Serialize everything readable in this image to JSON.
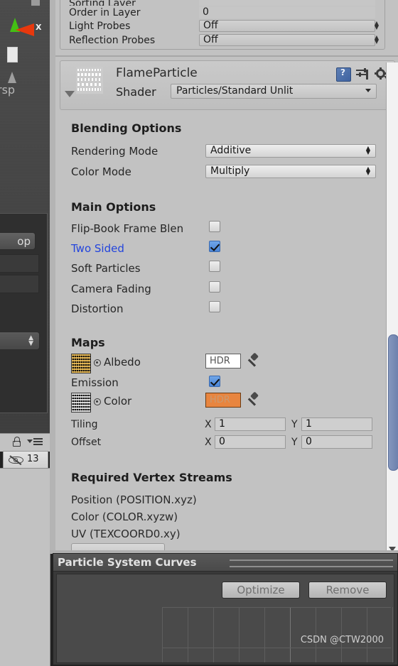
{
  "scene_view": {
    "gizmo_axis_label": "X",
    "projection_label": "rsp",
    "popup_button_label": "op"
  },
  "left_toolbar": {
    "eye_count": "13"
  },
  "renderer_section": {
    "rows": [
      {
        "label": "Sorting Layer",
        "value": "",
        "type": "plain"
      },
      {
        "label": "Order in Layer",
        "value": "0",
        "type": "plain"
      },
      {
        "label": "Light Probes",
        "value": "Off",
        "type": "dropdown"
      },
      {
        "label": "Reflection Probes",
        "value": "Off",
        "type": "dropdown"
      }
    ]
  },
  "material_header": {
    "name": "FlameParticle",
    "shader_label": "Shader",
    "shader_value": "Particles/Standard Unlit",
    "icons": {
      "help": "help-book-icon",
      "preset": "preset-slider-icon",
      "settings": "gear-icon"
    }
  },
  "blending_options": {
    "title": "Blending Options",
    "rendering_mode": {
      "label": "Rendering Mode",
      "value": "Additive"
    },
    "color_mode": {
      "label": "Color Mode",
      "value": "Multiply"
    }
  },
  "main_options": {
    "title": "Main Options",
    "items": [
      {
        "label": "Flip-Book Frame Blen",
        "checked": false,
        "highlighted": false
      },
      {
        "label": "Two Sided",
        "checked": true,
        "highlighted": true
      },
      {
        "label": "Soft Particles",
        "checked": false,
        "highlighted": false
      },
      {
        "label": "Camera Fading",
        "checked": false,
        "highlighted": false
      },
      {
        "label": "Distortion",
        "checked": false,
        "highlighted": false
      }
    ]
  },
  "maps": {
    "title": "Maps",
    "albedo": {
      "label": "Albedo",
      "hdr_label": "HDR",
      "swatch_color": "#ffffff"
    },
    "emission": {
      "label": "Emission",
      "checked": true
    },
    "color": {
      "label": "Color",
      "hdr_label": "HDR",
      "swatch_color": "#e8853f"
    },
    "tiling": {
      "label": "Tiling",
      "x_label": "X",
      "x_value": "1",
      "y_label": "Y",
      "y_value": "1"
    },
    "offset": {
      "label": "Offset",
      "x_label": "X",
      "x_value": "0",
      "y_label": "Y",
      "y_value": "0"
    }
  },
  "vertex_streams": {
    "title": "Required Vertex Streams",
    "lines": [
      "Position (POSITION.xyz)",
      "Color (COLOR.xyzw)",
      "UV (TEXCOORD0.xy)"
    ]
  },
  "curves_panel": {
    "tab_label": "Particle System Curves",
    "optimize_button": "Optimize",
    "remove_button": "Remove"
  },
  "watermark": "CSDN @CTW2000",
  "colors": {
    "panel_bg": "#c2c2c2",
    "accent_blue": "#2244dd",
    "checkbox_on": "#4a85d6",
    "hdr_orange": "#e8853f",
    "scrollbar": "#6d81ad",
    "gizmo_red": "#e8380d"
  }
}
